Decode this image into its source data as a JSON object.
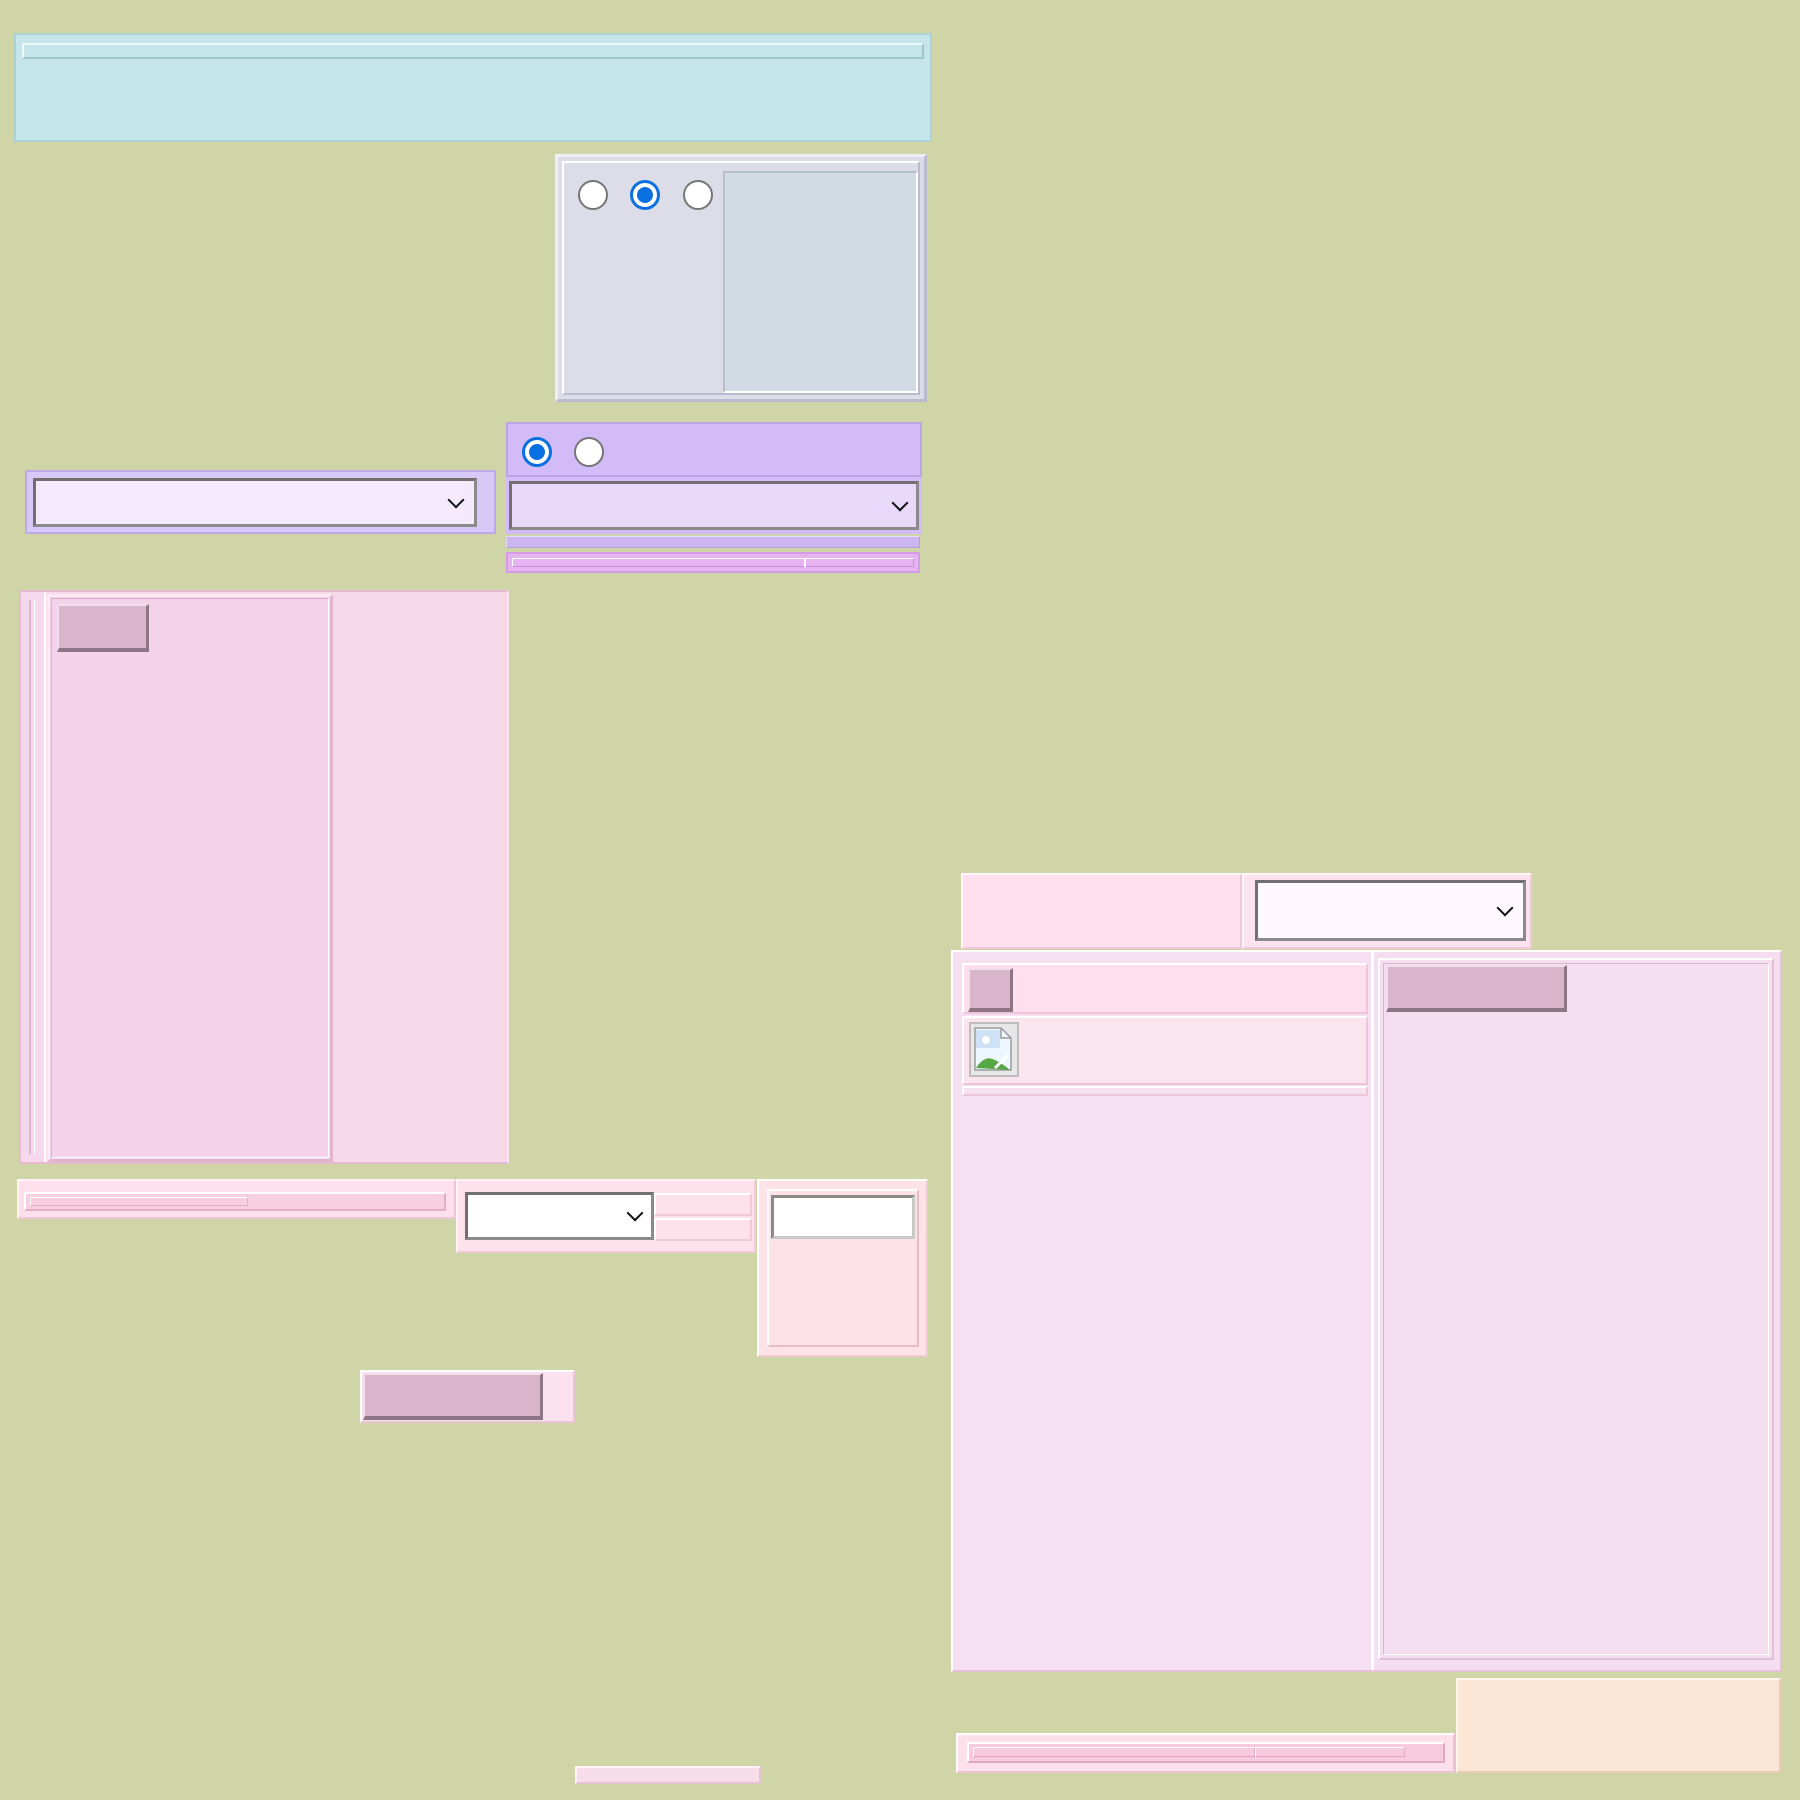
{
  "colors": {
    "background": "#cfd5a7",
    "top_panel": "#c4e6ea",
    "radio_panel": "#dcdde9",
    "radio_panel_inner": "#d2dbe3",
    "violet_panel": "#d3bbf7",
    "violet_select": "#e8d8fa",
    "lilac_select": "#f5eafd",
    "pink_panel": "#f5d1e8",
    "pink_light": "#ffdfee",
    "peach_panel": "#fbe6d6",
    "radio_accent": "#0a6fe0",
    "button_face": "#d9b5cb"
  },
  "radio_group_top": {
    "options": [
      {
        "checked": false
      },
      {
        "checked": true
      },
      {
        "checked": false
      }
    ]
  },
  "radio_group_violet": {
    "options": [
      {
        "checked": true
      },
      {
        "checked": false
      }
    ]
  },
  "selects": {
    "lilac_select": {
      "value": ""
    },
    "violet_select": {
      "value": ""
    },
    "pink_select_bottom": {
      "value": ""
    },
    "right_select": {
      "value": ""
    }
  },
  "inputs": {
    "small_text_input": {
      "value": "",
      "placeholder": ""
    }
  },
  "buttons": {
    "left_panel_button": "",
    "right_panel_small_button": "",
    "right_panel_wide_button": "",
    "standalone_button": ""
  },
  "icons": {
    "broken_image": "image-icon"
  }
}
